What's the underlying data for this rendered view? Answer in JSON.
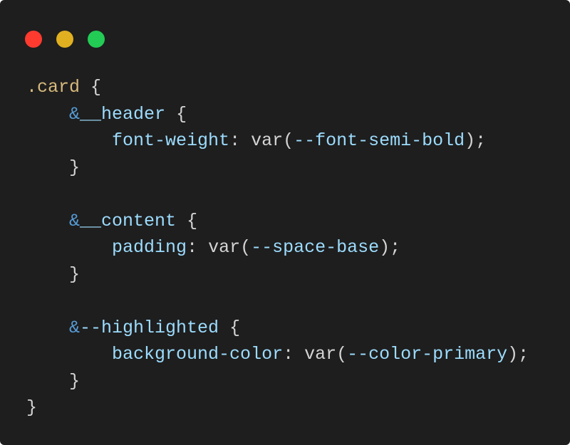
{
  "window": {
    "background": "#1e1e1e",
    "controls": [
      {
        "name": "close",
        "color": "#ff3b30"
      },
      {
        "name": "minimize",
        "color": "#e0b020"
      },
      {
        "name": "maximize",
        "color": "#22cc55"
      }
    ]
  },
  "code": {
    "language": "scss",
    "lines": [
      [
        {
          "t": ".card",
          "c": "selector"
        },
        {
          "t": " {",
          "c": "punct"
        }
      ],
      [
        {
          "t": "    ",
          "c": "punct"
        },
        {
          "t": "&",
          "c": "amp"
        },
        {
          "t": "__header",
          "c": "nested"
        },
        {
          "t": " {",
          "c": "punct"
        }
      ],
      [
        {
          "t": "        ",
          "c": "punct"
        },
        {
          "t": "font-weight",
          "c": "prop"
        },
        {
          "t": ": ",
          "c": "punct"
        },
        {
          "t": "var",
          "c": "func"
        },
        {
          "t": "(",
          "c": "punct"
        },
        {
          "t": "--font-semi-bold",
          "c": "var"
        },
        {
          "t": ");",
          "c": "punct"
        }
      ],
      [
        {
          "t": "    }",
          "c": "punct"
        }
      ],
      [],
      [
        {
          "t": "    ",
          "c": "punct"
        },
        {
          "t": "&",
          "c": "amp"
        },
        {
          "t": "__content",
          "c": "nested"
        },
        {
          "t": " {",
          "c": "punct"
        }
      ],
      [
        {
          "t": "        ",
          "c": "punct"
        },
        {
          "t": "padding",
          "c": "prop"
        },
        {
          "t": ": ",
          "c": "punct"
        },
        {
          "t": "var",
          "c": "func"
        },
        {
          "t": "(",
          "c": "punct"
        },
        {
          "t": "--space-base",
          "c": "var"
        },
        {
          "t": ");",
          "c": "punct"
        }
      ],
      [
        {
          "t": "    }",
          "c": "punct"
        }
      ],
      [],
      [
        {
          "t": "    ",
          "c": "punct"
        },
        {
          "t": "&",
          "c": "amp"
        },
        {
          "t": "--highlighted",
          "c": "nested"
        },
        {
          "t": " {",
          "c": "punct"
        }
      ],
      [
        {
          "t": "        ",
          "c": "punct"
        },
        {
          "t": "background-color",
          "c": "prop"
        },
        {
          "t": ": ",
          "c": "punct"
        },
        {
          "t": "var",
          "c": "func"
        },
        {
          "t": "(",
          "c": "punct"
        },
        {
          "t": "--color-primary",
          "c": "var"
        },
        {
          "t": ");",
          "c": "punct"
        }
      ],
      [
        {
          "t": "    }",
          "c": "punct"
        }
      ],
      [
        {
          "t": "}",
          "c": "punct"
        }
      ]
    ]
  }
}
